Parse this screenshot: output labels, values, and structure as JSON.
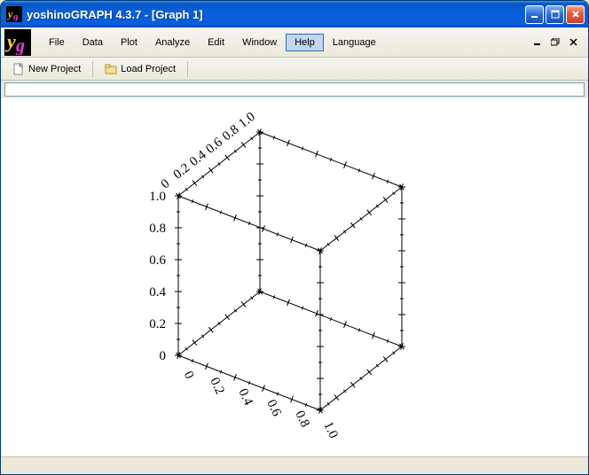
{
  "window": {
    "title": "yoshinoGRAPH 4.3.7 - [Graph 1]"
  },
  "menu": {
    "items": [
      "File",
      "Data",
      "Plot",
      "Analyze",
      "Edit",
      "Window",
      "Help",
      "Language"
    ],
    "highlighted_index": 6
  },
  "toolbar": {
    "new_project": "New Project",
    "load_project": "Load Project"
  },
  "formula": {
    "value": ""
  },
  "chart_data": {
    "type": "3d-box",
    "x": {
      "min": 0,
      "max": 1.0,
      "ticks": [
        0,
        0.2,
        0.4,
        0.6,
        0.8,
        1.0
      ]
    },
    "y": {
      "min": 0,
      "max": 1.0,
      "ticks": [
        0,
        0.2,
        0.4,
        0.6,
        0.8,
        1.0
      ]
    },
    "z": {
      "min": 0,
      "max": 1.0,
      "ticks": [
        0,
        0.2,
        0.4,
        0.6,
        0.8,
        1.0
      ]
    },
    "series": []
  },
  "colors": {
    "titlebar": "#0A5EDB",
    "menu_highlight_bg": "#C2D5F3",
    "menu_highlight_border": "#316AC5"
  }
}
